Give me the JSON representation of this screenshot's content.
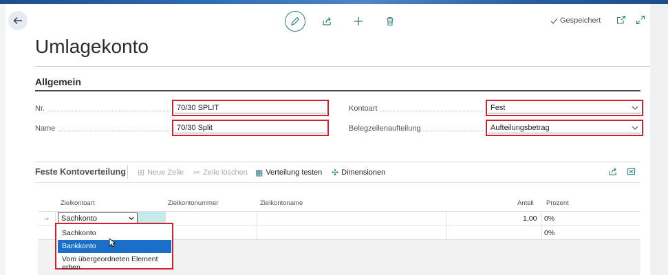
{
  "page": {
    "title": "Umlagekonto"
  },
  "toolbar": {
    "saved_label": "Gespeichert"
  },
  "general": {
    "section_title": "Allgemein",
    "nr_label": "Nr.",
    "nr_value": "70/30 SPLIT",
    "name_label": "Name",
    "name_value": "70/30 Split",
    "kontoart_label": "Kontoart",
    "kontoart_value": "Fest",
    "belegzeilen_label": "Belegzeilenaufteilung",
    "belegzeilen_value": "Aufteilungsbetrag"
  },
  "subpage": {
    "title": "Feste Kontoverteilung",
    "actions": {
      "new_line": "Neue Zeile",
      "delete_line": "Zeile löschen",
      "test": "Verteilung testen",
      "dimensions": "Dimensionen"
    },
    "columns": {
      "zielkontoart": "Zielkontoart",
      "zielkontonummer": "Zielkontonummer",
      "zielkontoname": "Zielkontoname",
      "anteil": "Anteil",
      "prozent": "Prozent"
    },
    "rows": [
      {
        "zielkontoart": "Sachkonto",
        "anteil": "1,00",
        "prozent": "0%"
      },
      {
        "prozent": "0%"
      }
    ],
    "dropdown_options": [
      "Sachkonto",
      "Bankkonto",
      "Vom übergeordneten Element erben"
    ],
    "dropdown_highlighted": "Bankkonto"
  },
  "colors": {
    "accent": "#2d7f7a",
    "highlight_frame": "#d0202f",
    "selected_option": "#1a6fc8"
  }
}
